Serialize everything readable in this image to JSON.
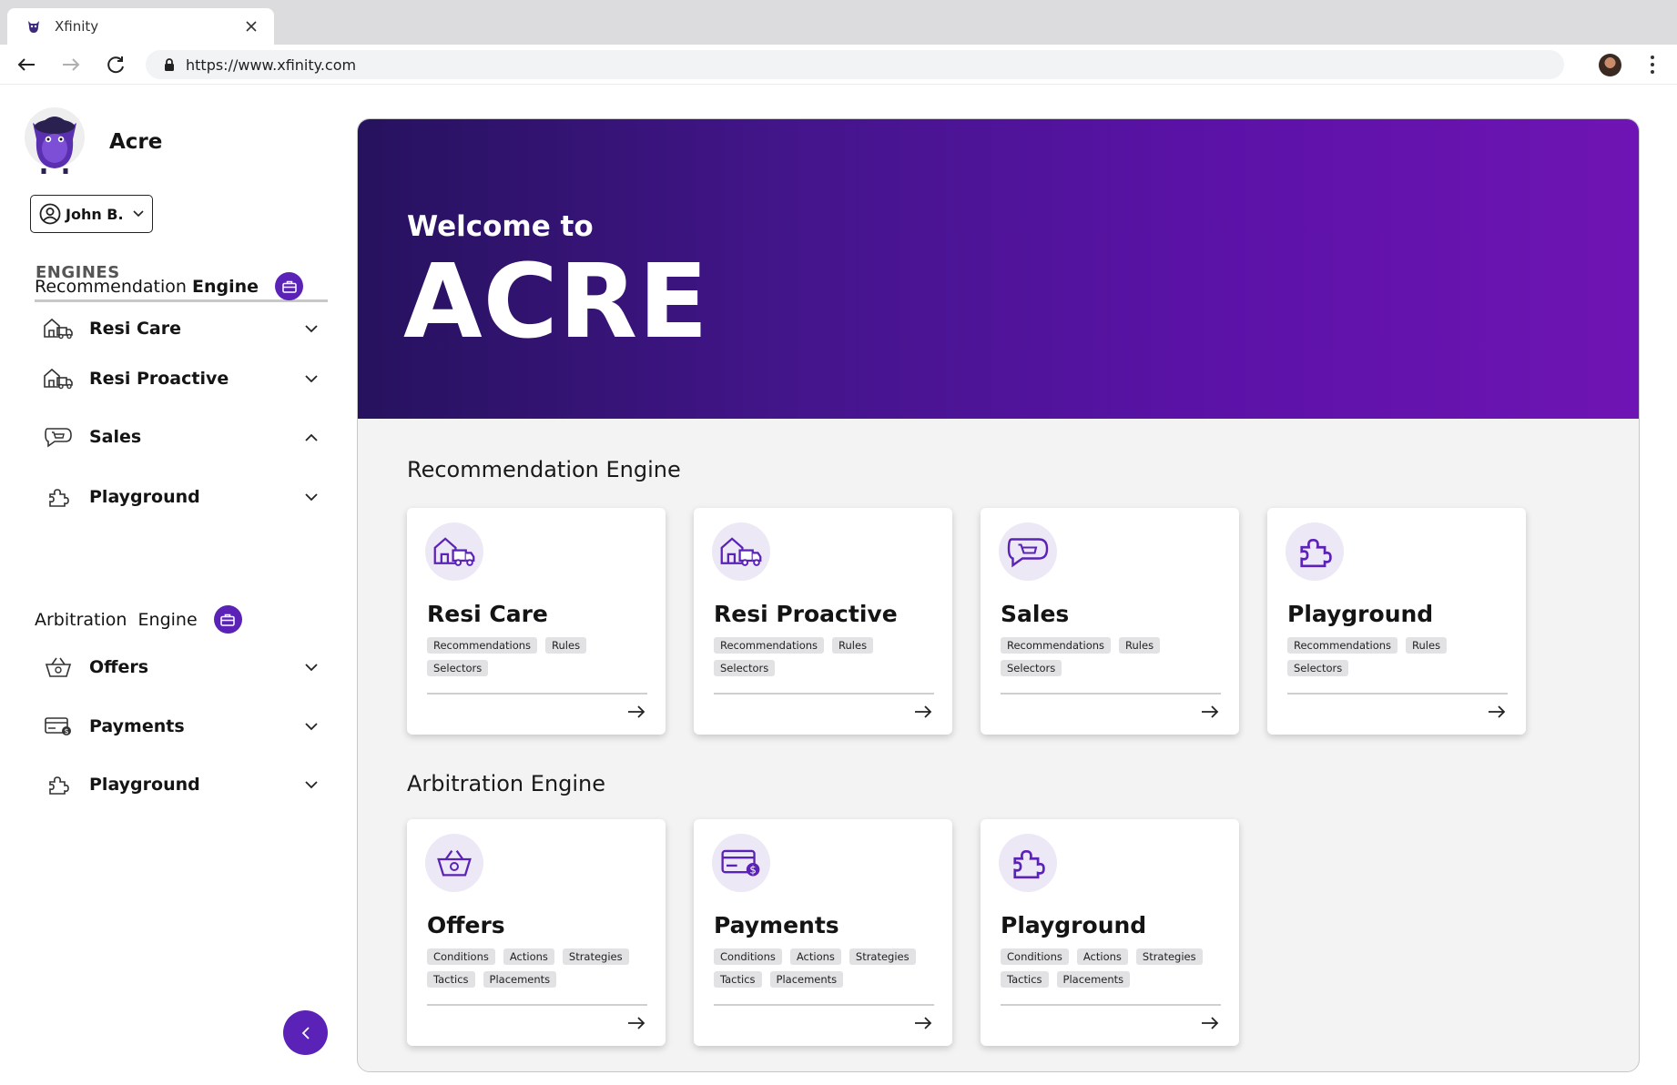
{
  "browser": {
    "tab_title": "Xfinity",
    "url": "https://www.xfinity.com"
  },
  "sidebar": {
    "app_name": "Acre",
    "user": "John B.",
    "engines_title": "ENGINES",
    "recommendation_engine": {
      "title_regular": "Recommendation",
      "title_bold": "Engine",
      "items": [
        {
          "label": "Resi Care",
          "icon": "house-truck-icon",
          "expanded": false
        },
        {
          "label": "Resi Proactive",
          "icon": "house-truck-icon",
          "expanded": false
        },
        {
          "label": "Sales",
          "icon": "cart-icon",
          "expanded": true
        },
        {
          "label": "Playground",
          "icon": "puzzle-icon",
          "expanded": false
        }
      ]
    },
    "arbitration_engine": {
      "title": "Arbitration  Engine",
      "items": [
        {
          "label": "Offers",
          "icon": "basket-icon",
          "expanded": false
        },
        {
          "label": "Payments",
          "icon": "card-dollar-icon",
          "expanded": false
        },
        {
          "label": "Playground",
          "icon": "puzzle-icon",
          "expanded": false
        }
      ]
    }
  },
  "hero": {
    "subtitle": "Welcome to",
    "title": "ACRE"
  },
  "sections": {
    "recommendation": {
      "title": "Recommendation Engine",
      "cards": [
        {
          "title": "Resi Care",
          "icon": "house-truck-icon",
          "tags": [
            "Recommendations",
            "Rules",
            "Selectors"
          ]
        },
        {
          "title": "Resi Proactive",
          "icon": "house-truck-icon",
          "tags": [
            "Recommendations",
            "Rules",
            "Selectors"
          ]
        },
        {
          "title": "Sales",
          "icon": "cart-icon",
          "tags": [
            "Recommendations",
            "Rules",
            "Selectors"
          ]
        },
        {
          "title": "Playground",
          "icon": "puzzle-icon",
          "tags": [
            "Recommendations",
            "Rules",
            "Selectors"
          ]
        }
      ]
    },
    "arbitration": {
      "title": "Arbitration Engine",
      "cards": [
        {
          "title": "Offers",
          "icon": "basket-icon",
          "tags": [
            "Conditions",
            "Actions",
            "Strategies",
            "Tactics",
            "Placements"
          ]
        },
        {
          "title": "Payments",
          "icon": "card-dollar-icon",
          "tags": [
            "Conditions",
            "Actions",
            "Strategies",
            "Tactics",
            "Placements"
          ]
        },
        {
          "title": "Playground",
          "icon": "puzzle-icon",
          "tags": [
            "Conditions",
            "Actions",
            "Strategies",
            "Tactics",
            "Placements"
          ]
        }
      ]
    }
  },
  "colors": {
    "accent": "#5b22b8",
    "hero_start": "#26125e",
    "hero_end": "#6f14b4",
    "icon_bg": "#ede8f5"
  }
}
